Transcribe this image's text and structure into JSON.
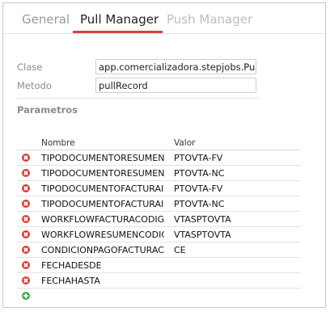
{
  "tabs": [
    {
      "label": "General"
    },
    {
      "label": "Pull Manager"
    },
    {
      "label": "Push Manager"
    }
  ],
  "form": {
    "clase_label": "Clase",
    "clase_value": "app.comercializadora.stepjobs.Punt",
    "metodo_label": "Metodo",
    "metodo_value": "pullRecord"
  },
  "parametros": {
    "title": "Parametros",
    "columns": {
      "nombre": "Nombre",
      "valor": "Valor"
    },
    "rows": [
      {
        "nombre": "TIPODOCUMENTORESUMEN",
        "valor": "PTOVTA-FV"
      },
      {
        "nombre": "TIPODOCUMENTORESUMEN",
        "valor": "PTOVTA-NC"
      },
      {
        "nombre": "TIPODOCUMENTOFACTURAI",
        "valor": "PTOVTA-FV"
      },
      {
        "nombre": "TIPODOCUMENTOFACTURAI",
        "valor": "PTOVTA-NC"
      },
      {
        "nombre": "WORKFLOWFACTURACODIG",
        "valor": "VTASPTOVTA"
      },
      {
        "nombre": "WORKFLOWRESUMENCODIC",
        "valor": "VTASPTOVTA"
      },
      {
        "nombre": "CONDICIONPAGOFACTURAC",
        "valor": "CE"
      },
      {
        "nombre": "FECHADESDE",
        "valor": ""
      },
      {
        "nombre": "FECHAHASTA",
        "valor": ""
      }
    ]
  },
  "colors": {
    "accent": "#d0433f",
    "delete": "#e0382f",
    "add": "#3aa84a"
  },
  "icons": {
    "delete": "delete-circle-icon",
    "add": "add-circle-icon"
  }
}
